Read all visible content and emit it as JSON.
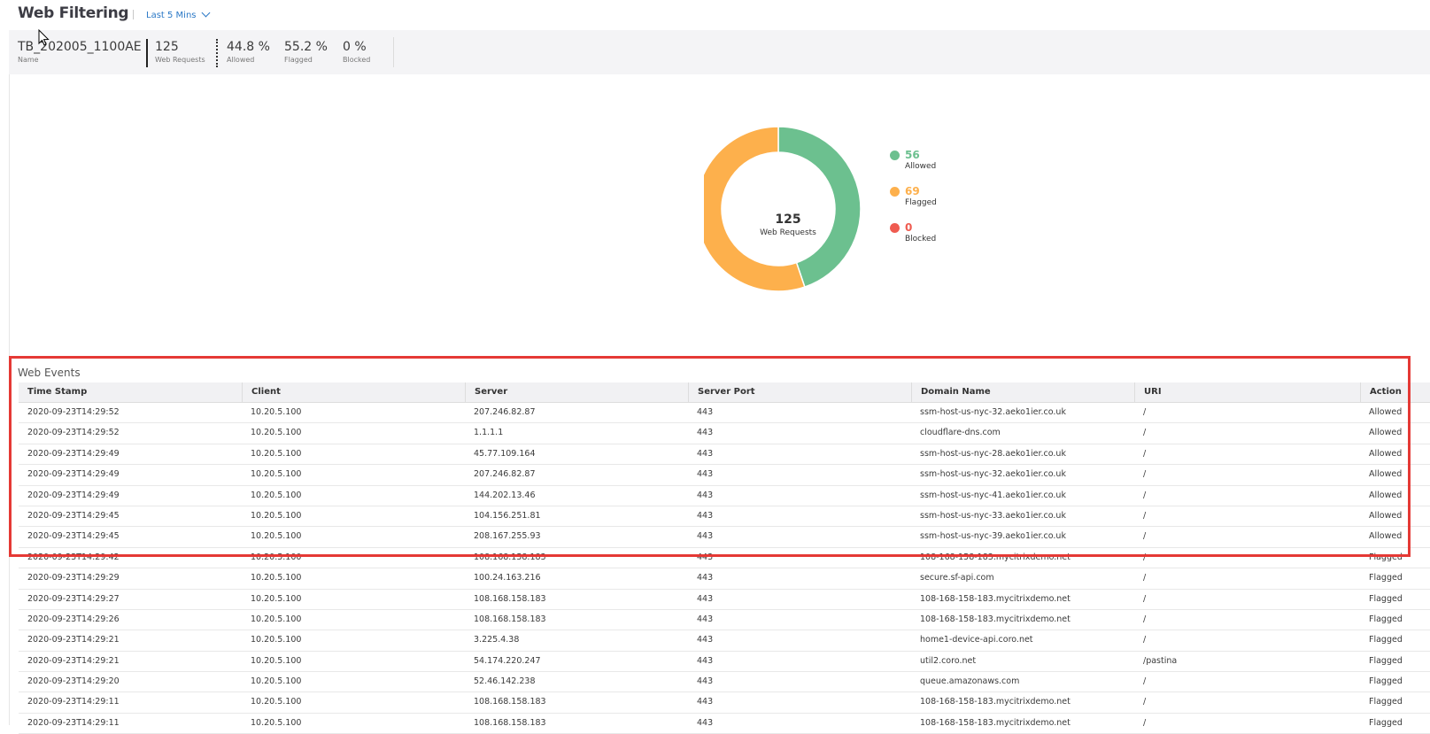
{
  "header": {
    "title": "Web Filtering",
    "time_filter": "Last 5 Mins"
  },
  "summary": {
    "name": {
      "value": "TB_202005_1100AE",
      "label": "Name"
    },
    "web_requests": {
      "value": "125",
      "label": "Web Requests"
    },
    "allowed": {
      "value": "44.8 %",
      "label": "Allowed"
    },
    "flagged": {
      "value": "55.2 %",
      "label": "Flagged"
    },
    "blocked": {
      "value": "0 %",
      "label": "Blocked"
    }
  },
  "donut": {
    "total": "125",
    "total_label": "Web Requests",
    "segments": [
      {
        "label": "Allowed",
        "value": 56,
        "color": "#6cc08f"
      },
      {
        "label": "Flagged",
        "value": 69,
        "color": "#fdb04c"
      },
      {
        "label": "Blocked",
        "value": 0,
        "color": "#ef5b50"
      }
    ]
  },
  "events": {
    "title": "Web Events",
    "columns": [
      "Time Stamp",
      "Client",
      "Server",
      "Server Port",
      "Domain Name",
      "URI",
      "Action"
    ],
    "rows": [
      [
        "2020-09-23T14:29:52",
        "10.20.5.100",
        "207.246.82.87",
        "443",
        "ssm-host-us-nyc-32.aeko1ier.co.uk",
        "/",
        "Allowed"
      ],
      [
        "2020-09-23T14:29:52",
        "10.20.5.100",
        "1.1.1.1",
        "443",
        "cloudflare-dns.com",
        "/",
        "Allowed"
      ],
      [
        "2020-09-23T14:29:49",
        "10.20.5.100",
        "45.77.109.164",
        "443",
        "ssm-host-us-nyc-28.aeko1ier.co.uk",
        "/",
        "Allowed"
      ],
      [
        "2020-09-23T14:29:49",
        "10.20.5.100",
        "207.246.82.87",
        "443",
        "ssm-host-us-nyc-32.aeko1ier.co.uk",
        "/",
        "Allowed"
      ],
      [
        "2020-09-23T14:29:49",
        "10.20.5.100",
        "144.202.13.46",
        "443",
        "ssm-host-us-nyc-41.aeko1ier.co.uk",
        "/",
        "Allowed"
      ],
      [
        "2020-09-23T14:29:45",
        "10.20.5.100",
        "104.156.251.81",
        "443",
        "ssm-host-us-nyc-33.aeko1ier.co.uk",
        "/",
        "Allowed"
      ],
      [
        "2020-09-23T14:29:45",
        "10.20.5.100",
        "208.167.255.93",
        "443",
        "ssm-host-us-nyc-39.aeko1ier.co.uk",
        "/",
        "Allowed"
      ],
      [
        "2020-09-23T14:29:42",
        "10.20.5.100",
        "108.168.158.183",
        "443",
        "108-168-158-183.mycitrixdemo.net",
        "/",
        "Flagged"
      ],
      [
        "2020-09-23T14:29:29",
        "10.20.5.100",
        "100.24.163.216",
        "443",
        "secure.sf-api.com",
        "/",
        "Flagged"
      ],
      [
        "2020-09-23T14:29:27",
        "10.20.5.100",
        "108.168.158.183",
        "443",
        "108-168-158-183.mycitrixdemo.net",
        "/",
        "Flagged"
      ],
      [
        "2020-09-23T14:29:26",
        "10.20.5.100",
        "108.168.158.183",
        "443",
        "108-168-158-183.mycitrixdemo.net",
        "/",
        "Flagged"
      ],
      [
        "2020-09-23T14:29:21",
        "10.20.5.100",
        "3.225.4.38",
        "443",
        "home1-device-api.coro.net",
        "/",
        "Flagged"
      ],
      [
        "2020-09-23T14:29:21",
        "10.20.5.100",
        "54.174.220.247",
        "443",
        "util2.coro.net",
        "/pastina",
        "Flagged"
      ],
      [
        "2020-09-23T14:29:20",
        "10.20.5.100",
        "52.46.142.238",
        "443",
        "queue.amazonaws.com",
        "/",
        "Flagged"
      ],
      [
        "2020-09-23T14:29:11",
        "10.20.5.100",
        "108.168.158.183",
        "443",
        "108-168-158-183.mycitrixdemo.net",
        "/",
        "Flagged"
      ],
      [
        "2020-09-23T14:29:11",
        "10.20.5.100",
        "108.168.158.183",
        "443",
        "108-168-158-183.mycitrixdemo.net",
        "/",
        "Flagged"
      ]
    ]
  }
}
